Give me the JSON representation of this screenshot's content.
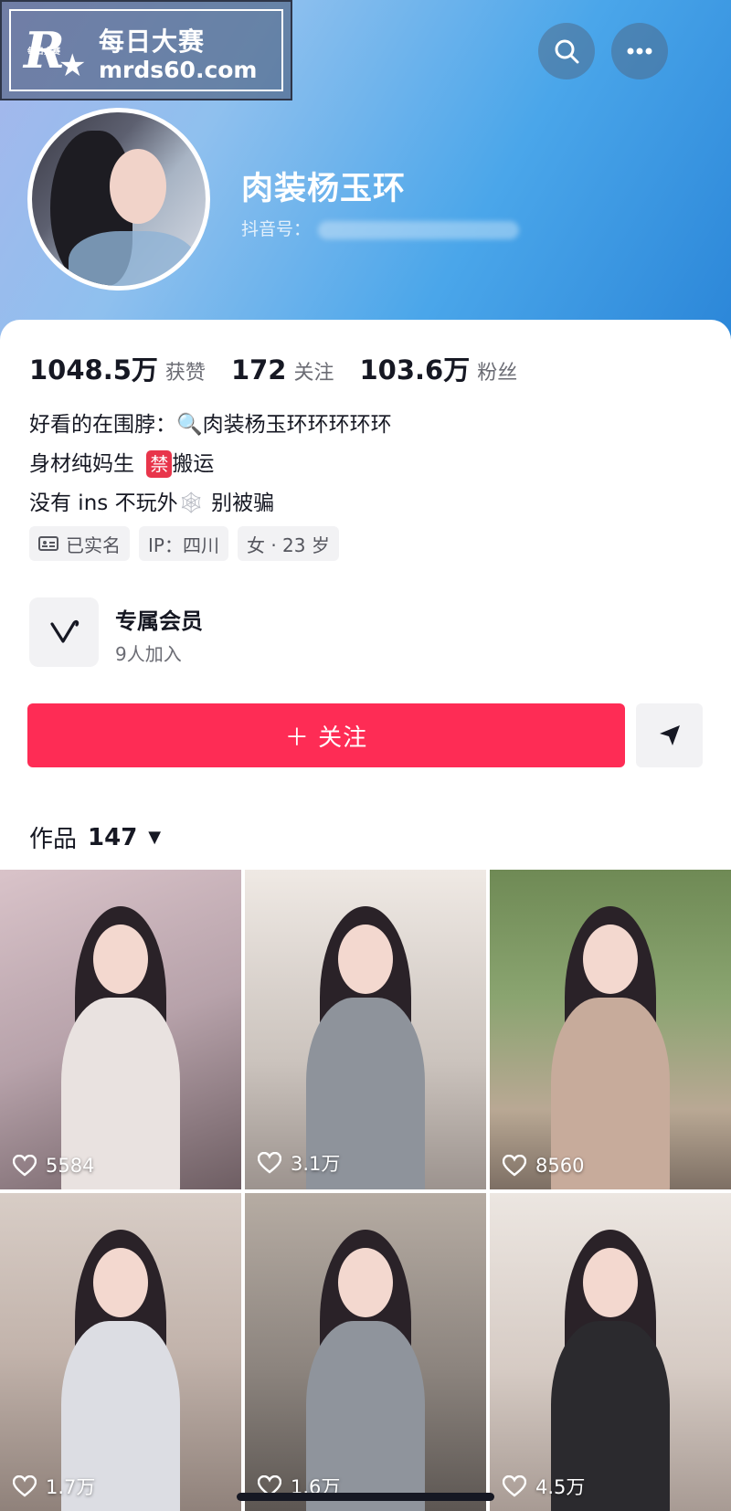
{
  "watermark": {
    "logo_letter": "R",
    "logo_small": "每日大赛",
    "title": "每日大赛",
    "url": "mrds60.com"
  },
  "header": {
    "search_icon": "search-icon",
    "more_icon": "more-icon"
  },
  "profile": {
    "nickname": "肉装杨玉环",
    "douyin_id_label": "抖音号："
  },
  "stats": [
    {
      "num": "1048.5万",
      "label": "获赞"
    },
    {
      "num": "172",
      "label": "关注"
    },
    {
      "num": "103.6万",
      "label": "粉丝"
    }
  ],
  "bio": {
    "line1_prefix": "好看的在围脖：",
    "line1_suffix": "肉装杨玉环环环环环",
    "line2_prefix": "身材纯妈生",
    "line2_badge": "禁",
    "line2_suffix": "搬运",
    "line3_prefix": "没有 ins 不玩外",
    "line3_suffix": " 别被骗"
  },
  "tags": {
    "verified": "已实名",
    "ip": "IP：四川",
    "gender_age": "女 · 23 岁"
  },
  "member": {
    "title": "专属会员",
    "subtitle": "9人加入"
  },
  "actions": {
    "follow": "＋ 关注"
  },
  "works": {
    "label": "作品",
    "count": "147",
    "caret": "▼"
  },
  "videos": [
    {
      "likes": "5584"
    },
    {
      "likes": "3.1万"
    },
    {
      "likes": "8560"
    },
    {
      "likes": "1.7万"
    },
    {
      "likes": "1.6万"
    },
    {
      "likes": "4.5万"
    }
  ],
  "colors": {
    "accent": "#fe2c55",
    "header_start": "#a7b6ec",
    "header_end": "#2b86d8"
  }
}
